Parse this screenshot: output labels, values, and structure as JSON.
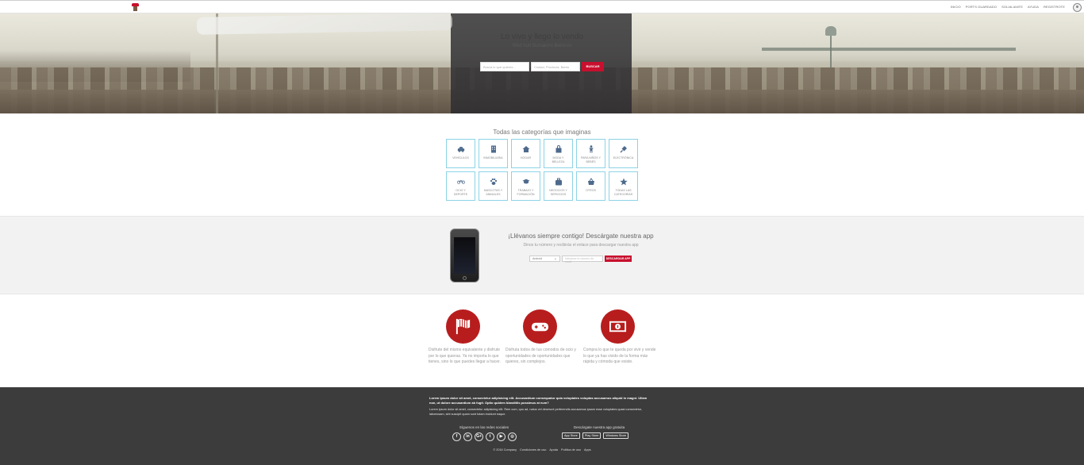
{
  "header": {
    "nav": [
      "INICIO",
      "PORTS GUARDADO",
      "SOLIALIANTE",
      "AYUDA",
      "REGISTROTE"
    ]
  },
  "hero": {
    "title": "Lo vivo y llego lo vendo",
    "subtitle": "Wkd hurl Burrakmo Bellecor",
    "search_placeholder": "Busca lo que quieres...",
    "location_placeholder": "Ciudad, Provincia, Barrio",
    "search_button": "BUSCAR"
  },
  "categories": {
    "title": "Todas las categorías que imaginas",
    "items": [
      {
        "label": "VEHÍCULOS",
        "icon": "car-icon"
      },
      {
        "label": "INMOBILIARIA",
        "icon": "building-icon"
      },
      {
        "label": "HOGAR",
        "icon": "home-icon"
      },
      {
        "label": "MODA Y BELLEZA",
        "icon": "bag-icon"
      },
      {
        "label": "PARA NIÑOS Y BEBÉS",
        "icon": "child-icon"
      },
      {
        "label": "ELECTRÓNICA",
        "icon": "plug-icon"
      },
      {
        "label": "OCIO Y DEPORTE",
        "icon": "bicycle-icon"
      },
      {
        "label": "MASCOTAS Y ANIMALES",
        "icon": "paw-icon"
      },
      {
        "label": "TRABAJO Y FORMACIÓN",
        "icon": "graduation-cap-icon"
      },
      {
        "label": "NEGOCIOS Y SERVICIOS",
        "icon": "briefcase-icon"
      },
      {
        "label": "OTROS",
        "icon": "basket-icon"
      },
      {
        "label": "TODAS LAS CATEGORÍAS",
        "icon": "star-icon"
      }
    ]
  },
  "app_promo": {
    "title": "¡Llévanos siempre contigo! Descárgate nuestra app",
    "subtitle": "Dinos tu número y recibirás el enlace para descargar nuestra app",
    "os_selected": "Android",
    "phone_placeholder": "Introduce tu número de móvil",
    "button": "DESCARGAR APP"
  },
  "features": [
    {
      "icon": "flag-icon",
      "text": "Disfrute del mismo equivalente y disfrute por lo que quieras. Ya no importa lo que tienes, sino lo que puedes llegar a hacer."
    },
    {
      "icon": "gamepad-icon",
      "text": "Disfruta todos de tus comodos de ocio y oportunidades de oportunidades que quieres, sin complejos."
    },
    {
      "icon": "money-icon",
      "text": "Compra lo que te queda por vivir y vende lo que ya has vivido de la forma más rápida y cómoda que existe."
    }
  ],
  "footer": {
    "lorem_bold": "Lorem ipsum dolor sit amet, consectetur adipisicing elit. Accusantium consequatur quia voluptates voluptas accusamus aliquid in magni. Ullam non, ut dolore accusantium ab fugit. Optio quidem blanditiis possimus at eum?",
    "lorem_small": "Lorem ipsum dolor sit amet, consectetur adipisicing elit. Rem cum, quo ad, natus vel deserunt perferendis accusamus ipsam esse voluptates quasi consectetur, laboriosam, sint suscipit quam sunt totam incidunt eaque.",
    "social_title": "Síguenos en las redes sociales",
    "social": [
      "f",
      "in",
      "G+",
      "t",
      "▶",
      "◎"
    ],
    "apps_title": "Descárgate nuestra app gratuita",
    "stores": [
      "App Store",
      "Play Store",
      "Windows Store"
    ],
    "links": [
      "© 2016 Company",
      "Condiciones de uso",
      "Ayuda",
      "Política de uso",
      "Apps"
    ]
  },
  "colors": {
    "accent": "#c8102e",
    "feature_circle": "#b81d1d",
    "category_border": "#8cd3e6",
    "footer_bg": "#3c3c3c"
  }
}
